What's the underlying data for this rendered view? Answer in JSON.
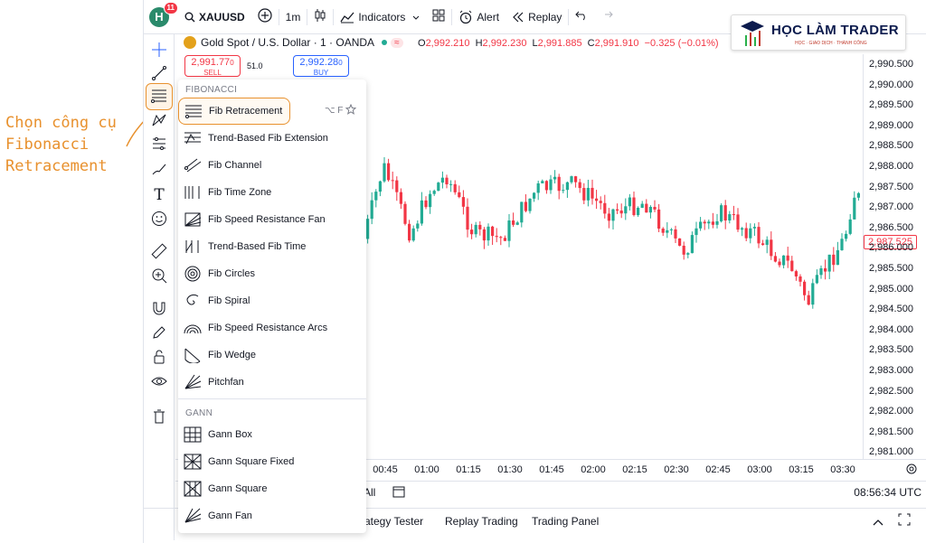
{
  "annotation": {
    "text": "Chọn công cụ Fibonacci Retracement"
  },
  "topbar": {
    "avatar_letter": "H",
    "notif_count": "11",
    "symbol": "XAUUSD",
    "interval": "1m",
    "indicators_label": "Indicators",
    "alert_label": "Alert",
    "replay_label": "Replay"
  },
  "logo": {
    "title": "HỌC LÀM TRADER",
    "subtitle": "HỌC · GIAO DỊCH · THÀNH CÔNG"
  },
  "chart_header": {
    "title": "Gold Spot / U.S. Dollar · 1 · OANDA",
    "ohlc": [
      {
        "label": "O",
        "value": "2,992.210"
      },
      {
        "label": "H",
        "value": "2,992.230"
      },
      {
        "label": "L",
        "value": "2,991.885"
      },
      {
        "label": "C",
        "value": "2,991.910"
      }
    ],
    "change": "−0.325 (−0.01%)",
    "sell_price": "2,991.77",
    "sell_price_small": "0",
    "sell_label": "SELL",
    "spread": "51.0",
    "buy_price": "2,992.28",
    "buy_price_small": "0",
    "buy_label": "BUY"
  },
  "price_scale": {
    "labels": [
      "2,990.500",
      "2,990.000",
      "2,989.500",
      "2,989.000",
      "2,988.500",
      "2,988.000",
      "2,987.500",
      "2,987.000",
      "2,986.500",
      "2,986.000",
      "2,985.500",
      "2,985.000",
      "2,984.500",
      "2,984.000",
      "2,983.500",
      "2,983.000",
      "2,982.500",
      "2,982.000",
      "2,981.500",
      "2,981.000"
    ],
    "last_price": "2,987.525"
  },
  "time_axis": {
    "labels": [
      "00:45",
      "01:00",
      "01:15",
      "01:30",
      "01:45",
      "02:00",
      "02:15",
      "02:30",
      "02:45",
      "03:00",
      "03:15",
      "03:30"
    ]
  },
  "range_bar": {
    "range_label": "All",
    "clock": "08:56:34 UTC"
  },
  "bottom_bar": {
    "tabs": [
      "rategy Tester",
      "Replay Trading",
      "Trading Panel"
    ]
  },
  "menu": {
    "fib_section": "FIBONACCI",
    "fib_items": [
      {
        "label": "Fib Retracement",
        "icon": "fib-retracement-icon"
      },
      {
        "label": "Trend-Based Fib Extension",
        "icon": "fib-extension-icon"
      },
      {
        "label": "Fib Channel",
        "icon": "fib-channel-icon"
      },
      {
        "label": "Fib Time Zone",
        "icon": "fib-time-zone-icon"
      },
      {
        "label": "Fib Speed Resistance Fan",
        "icon": "fib-fan-icon"
      },
      {
        "label": "Trend-Based Fib Time",
        "icon": "fib-time-icon"
      },
      {
        "label": "Fib Circles",
        "icon": "fib-circles-icon"
      },
      {
        "label": "Fib Spiral",
        "icon": "fib-spiral-icon"
      },
      {
        "label": "Fib Speed Resistance Arcs",
        "icon": "fib-arcs-icon"
      },
      {
        "label": "Fib Wedge",
        "icon": "fib-wedge-icon"
      },
      {
        "label": "Pitchfan",
        "icon": "pitchfan-icon"
      }
    ],
    "shortcut": "⌥ F",
    "gann_section": "GANN",
    "gann_items": [
      {
        "label": "Gann Box",
        "icon": "gann-box-icon"
      },
      {
        "label": "Gann Square Fixed",
        "icon": "gann-square-fixed-icon"
      },
      {
        "label": "Gann Square",
        "icon": "gann-square-icon"
      },
      {
        "label": "Gann Fan",
        "icon": "gann-fan-icon"
      }
    ]
  },
  "colors": {
    "up": "#22ab94",
    "down": "#f23645",
    "accent": "#e8912e"
  }
}
